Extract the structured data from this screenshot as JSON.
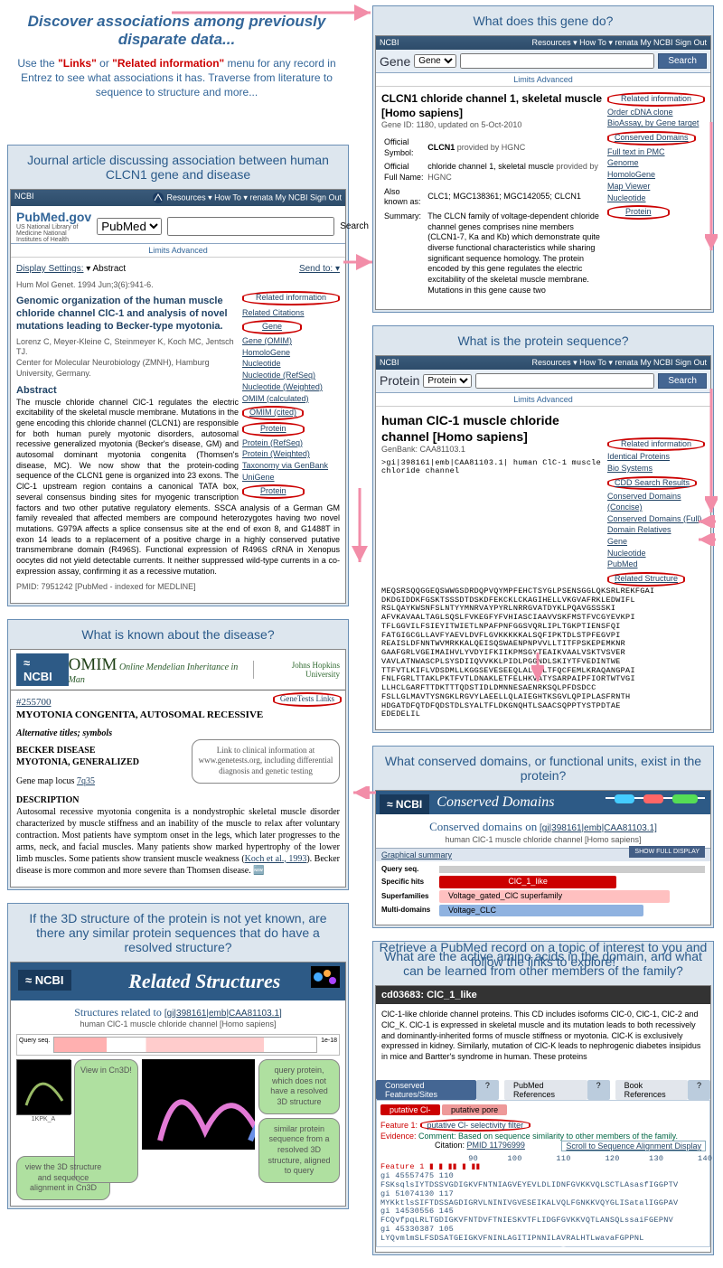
{
  "intro": {
    "title": "Discover associations among previously disparate data...",
    "text_before": "Use the ",
    "hot1": "\"Links\"",
    "mid": " or ",
    "hot2": "\"Related information\"",
    "text_after": " menu for any record in Entrez to see what associations it has. Traverse from literature to sequence to structure and more..."
  },
  "header": {
    "right_links": "Resources ▾   How To ▾                                renata   My NCBI   Sign Out",
    "ncbi_logo": "NCBI"
  },
  "pubmed": {
    "caption": "Journal article discussing association between human CLCN1 gene and disease",
    "dbname": "PubMed.gov",
    "subtitle": "US National Library of Medicine National Institutes of Health",
    "db_sel": "PubMed",
    "search_btn": "Search",
    "limits": "Limits   Advanced",
    "display": "Display Settings:",
    "abstract": "▾ Abstract",
    "sendto": "Send to: ▾",
    "journal": "Hum Mol Genet. 1994 Jun;3(6):941-6.",
    "title": "Genomic organization of the human muscle chloride channel ClC-1 and analysis of novel mutations leading to Becker-type myotonia.",
    "authors": "Lorenz C, Meyer-Kleine C, Steinmeyer K, Koch MC, Jentsch TJ.",
    "affil": "Center for Molecular Neurobiology (ZMNH), Hamburg University, Germany.",
    "abs_label": "Abstract",
    "abstract_text": "The muscle chloride channel ClC-1 regulates the electric excitability of the skeletal muscle membrane. Mutations in the gene encoding this chloride channel (CLCN1) are responsible for both human purely myotonic disorders, autosomal recessive generalized myotonia (Becker's disease, GM) and autosomal dominant myotonia congenita (Thomsen's disease, MC). We now show that the protein-coding sequence of the CLCN1 gene is organized into 23 exons. The ClC-1 upstream region contains a canonical TATA box, several consensus binding sites for myogenic transcription factors and two other putative regulatory elements. SSCA analysis of a German GM family revealed that affected members are compound heterozygotes having two novel mutations. G979A affects a splice consensus site at the end of exon 8, and G1488T in exon 14 leads to a replacement of a positive charge in a highly conserved putative transmembrane domain (R496S). Functional expression of R496S cRNA in Xenopus oocytes did not yield detectable currents. It neither suppressed wild-type currents in a co-expression assay, confirming it as a recessive mutation.",
    "pmid": "PMID: 7951242 [PubMed - indexed for MEDLINE]",
    "side_title": "Related information",
    "side_links": [
      "Related Citations",
      "Gene",
      "Gene (OMIM)",
      "HomoloGene",
      "Nucleotide",
      "Nucleotide (RefSeq)",
      "Nucleotide (Weighted)",
      "OMIM (calculated)",
      "OMIM (cited)",
      "Protein",
      "Protein (RefSeq)",
      "Protein (Weighted)",
      "Taxonomy via GenBank",
      "UniGene",
      "Protein"
    ]
  },
  "gene": {
    "caption": "What does this gene do?",
    "dbname": "Gene",
    "db_sel": "Gene",
    "search_btn": "Search",
    "limits": "Limits   Advanced",
    "title": "CLCN1 chloride channel 1, skeletal muscle [Homo sapiens]",
    "sub": "Gene ID: 1180, updated on 5-Oct-2010",
    "rows": {
      "sym_l": "Official Symbol:",
      "sym_v": "CLCN1",
      "sym_p": "provided by HGNC",
      "name_l": "Official Full Name:",
      "name_v": "chloride channel 1, skeletal muscle",
      "name_p": "provided by HGNC",
      "aka_l": "Also known as:",
      "aka_v": "CLC1; MGC138361; MGC142055; CLCN1",
      "sum_l": "Summary:",
      "sum_v": "The CLCN family of voltage-dependent chloride channel genes comprises nine members (CLCN1-7, Ka and Kb) which demonstrate quite diverse functional characteristics while sharing significant sequence homology. The protein encoded by this gene regulates the electric excitability of the skeletal muscle membrane. Mutations in this gene cause two"
    },
    "side_title": "Related information",
    "side_links": [
      "Order cDNA clone",
      "BioAssay, by Gene target",
      "Conserved Domains",
      "Full text in PMC",
      "Genome",
      "HomoloGene",
      "Map Viewer",
      "Nucleotide",
      "Protein"
    ]
  },
  "protein": {
    "caption": "What is the protein sequence?",
    "dbname": "Protein",
    "db_sel": "Protein",
    "search_btn": "Search",
    "limits": "Limits   Advanced",
    "title": "human ClC-1 muscle chloride channel [Homo sapiens]",
    "acc": "GenBank: CAA81103.1",
    "seq": ">gi|398161|emb|CAA81103.1| human ClC-1 muscle chloride channel\nMEQSRSQQGGEQSWWGSDRDQPVQYMPFEHCTSYGLPSENSGGLQKSRLREKFGAI\nDKDGIDDKFGSKTSSSDTDSKDFEKCKLCKAGIHELLVKGVAFRKLEDWIFL\nRSLQAYKWSNFSLNTYYMNRVAYPYRLNRRGVATDYKLPQAVGSSSKI\nAFVKAVAALTAGLSQSLFVKEGFYFVHIASCIAAVVSKFMSTFVCGYEVKPI\nTFLGGVILFSIEYITWIETLNPAFPNFGGSVQRLIPLTGKPTIENSFQI\nFATGIGCGLLAVFYAEVLDVFLGVKKKKKALSQFIPKTDLSTPFEGVPI\nREAISLDFNNTWVMRKKALQEISQSWAENPNPVVLLTITFPSKEPEMKNR\nGAAFGRLVGEIMAIHVLYVDYIFKIIKPMSGYTEAIKVAALVSKTVSVER\nVAVLATNWASCPLSYSDIIQVVKKLPIDLPGGNDLSKIYTFVEDINTWE\nTTFVTLKIFLVDSDMLLKGGSEVESEEQLALQHLTFQCFEMLKRAQANGPAI\nFNLFGRLTTAKLPKTFVTLDNAKLETFELHKVATYSARPAIPFIORTWTVGI\nLLHCLGARFTTDKTTTQDSTIDLDMNNESAENRKSQLPFDSDCC\nFSLLGLMAVTYSNGKLRGVYLAEELLQLAIEGHTKSGVLQPIPLASFRNTH\nHDGATDFQTDFQDSTDLSYALTFLDKGNQHTLSAACSQPPTYSTPDTAE\nEDEDELIL",
    "side_title": "Related information",
    "side_links": [
      "Identical Proteins",
      "Bio Systems",
      "CDD Search Results",
      "Conserved Domains (Concise)",
      "Conserved Domains (Full)",
      "Domain Relatives",
      "Gene",
      "Nucleotide",
      "PubMed",
      "Related Structure"
    ]
  },
  "omim": {
    "caption": "What is known about the disease?",
    "title": "OMIM",
    "subtitle": "Online Mendelian Inheritance in Man",
    "jhu": "Johns Hopkins University",
    "mim": "#255700",
    "disease": "MYOTONIA CONGENITA, AUTOSOMAL RECESSIVE",
    "alt": "Alternative titles; symbols",
    "alt1": "BECKER DISEASE",
    "alt2": "MYOTONIA, GENERALIZED",
    "map_l": "Gene map locus",
    "map_v": "7q35",
    "genetests": "GeneTests Links",
    "bubble": "Link to clinical information at www.genetests.org, including differential diagnosis and genetic testing",
    "desc_l": "DESCRIPTION",
    "desc": "Autosomal recessive myotonia congenita is a nondystrophic skeletal muscle disorder characterized by muscle stiffness and an inability of the muscle to relax after voluntary contraction. Most patients have symptom onset in the legs, which later progresses to the arms, neck, and facial muscles. Many patients show marked hypertrophy of the lower limb muscles. Some patients show transient muscle weakness (",
    "ref": "Koch et al., 1993",
    "desc_tail": "). Becker disease is more common and more severe than Thomsen disease."
  },
  "cdd": {
    "caption": "What conserved domains, or functional units, exist in the protein?",
    "header_title": "Conserved Domains",
    "on": "Conserved domains on",
    "target": "[gi|398161|emb|CAA81103.1]",
    "sub": "human ClC-1 muscle chloride channel [Homo sapiens]",
    "show_full": "SHOW FULL DISPLAY",
    "gs": "Graphical summary",
    "rows": {
      "query": "Query seq.",
      "specific": "Specific hits",
      "super": "Superfamilies",
      "multi": "Multi-domains",
      "clc": "ClC_1_like",
      "clcsuper": "Voltage_gated_ClC superfamily",
      "vclc": "Voltage_CLC"
    }
  },
  "family": {
    "caption": "What are the active amino acids in the domain, and what can be learned from other members of the family?",
    "cd": "cd03683:  ClC_1_like",
    "desc": "ClC-1-like chloride channel proteins. This CD includes isoforms ClC-0, ClC-1, ClC-2 and ClC_K. ClC-1 is expressed in skeletal muscle and its mutation leads to both recessively and dominantly-inherited forms of muscle stiffness or myotonia. ClC-K is exclusively expressed in kidney. Similarly, mutation of ClC-K leads to nephrogenic diabetes insipidus in mice and Bartter's syndrome in human. These proteins",
    "tab1": "Conserved Features/Sites",
    "tab2": "PubMed References",
    "tab3": "Book References",
    "pill1": "putative Cl-",
    "pill2": "putative pore",
    "feat_l": "Feature 1:",
    "feat_v": "putative Cl- selectivity filter",
    "ev_l": "Evidence:",
    "ev_v": "Comment: Based on sequence similarity to other members of the family.",
    "cit_l": "Citation:",
    "cit_v": "PMID 11796999",
    "scroll": "Scroll to Sequence Alignment Display",
    "align_hdr": "                  90      100       110       120      130       140",
    "align_lbl": "Feature 1",
    "lines": [
      "gi 45557475   110 FSKsqlsIYTDSSVGDIGKVFNTNIAGVEYEVLDLIDNFGVKKVQLSCTLAsasfIGGPTV",
      "gi 51074130   117 MYKktlsSIFTDSSAGDIGRVLNINIVGVESEIKALVQLFGNKKVQYGLISatalIGGPAV",
      "gi 14530556   145 FCQvfpqLRLTGDIGKVFNTDVFTNIESKVTFLIDGFGVKKVQTLANSQLssaiFGEPNV",
      "gi 45330387   105 LYQvmlmSLFSDSATGEIGKVFNINLAGITIPNNILAVRALHTLwavaFGPPNL"
    ]
  },
  "relstruct": {
    "caption": "If the 3D structure of the protein is not yet known, are there any similar protein sequences that do have a resolved structure?",
    "title": "Related Structures",
    "sub_pre": "Structures related to ",
    "sub_link": "[gi|398161|emb|CAA81103.1]",
    "sub2": "human ClC-1 muscle chloride channel [Homo sapiens]",
    "bubble_view": "View in Cn3D!",
    "bubble_bottom": "view the 3D structure and sequence alignment in Cn3D",
    "bubble_q": "query protein, which does not have a resolved 3D structure",
    "bubble_s": "similar protein sequence from a resolved 3D structure, aligned to query"
  },
  "footer": "Retrieve a PubMed record on a topic of interest to you and follow the links to explore!"
}
